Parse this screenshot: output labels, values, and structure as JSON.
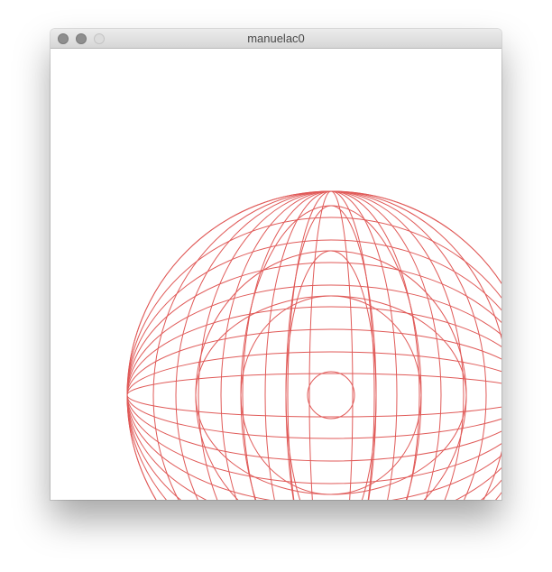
{
  "window": {
    "title": "manuelac0"
  },
  "icons": {
    "close": "close-button-icon",
    "minimize": "minimize-button-icon",
    "zoom": "zoom-button-icon"
  },
  "colors": {
    "stroke": "#e05a58",
    "background": "#ffffff"
  }
}
